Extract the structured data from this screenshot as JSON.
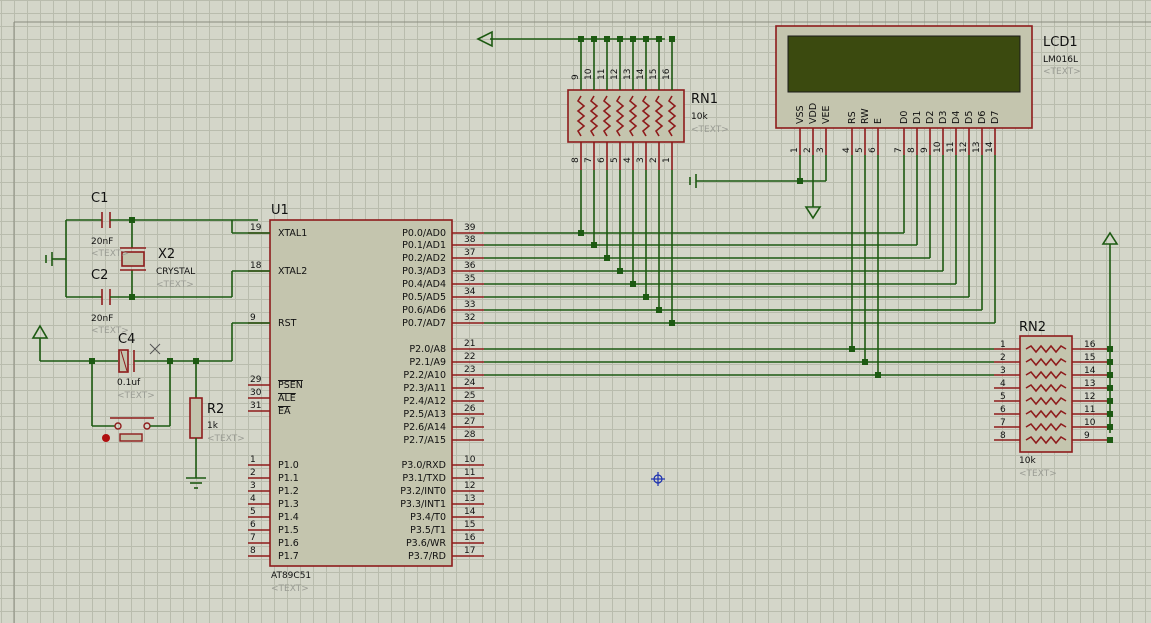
{
  "u1": {
    "ref": "U1",
    "part": "AT89C51",
    "text": "<TEXT>",
    "left": [
      {
        "num": "19",
        "name": "XTAL1"
      },
      {
        "num": "18",
        "name": "XTAL2"
      },
      {
        "num": "9",
        "name": "RST"
      },
      {
        "num": "29",
        "name": "PSEN"
      },
      {
        "num": "30",
        "name": "ALE"
      },
      {
        "num": "31",
        "name": "EA"
      },
      {
        "num": "1",
        "name": "P1.0"
      },
      {
        "num": "2",
        "name": "P1.1"
      },
      {
        "num": "3",
        "name": "P1.2"
      },
      {
        "num": "4",
        "name": "P1.3"
      },
      {
        "num": "5",
        "name": "P1.4"
      },
      {
        "num": "6",
        "name": "P1.5"
      },
      {
        "num": "7",
        "name": "P1.6"
      },
      {
        "num": "8",
        "name": "P1.7"
      }
    ],
    "right": [
      {
        "num": "39",
        "name": "P0.0/AD0"
      },
      {
        "num": "38",
        "name": "P0.1/AD1"
      },
      {
        "num": "37",
        "name": "P0.2/AD2"
      },
      {
        "num": "36",
        "name": "P0.3/AD3"
      },
      {
        "num": "35",
        "name": "P0.4/AD4"
      },
      {
        "num": "34",
        "name": "P0.5/AD5"
      },
      {
        "num": "33",
        "name": "P0.6/AD6"
      },
      {
        "num": "32",
        "name": "P0.7/AD7"
      },
      {
        "num": "21",
        "name": "P2.0/A8"
      },
      {
        "num": "22",
        "name": "P2.1/A9"
      },
      {
        "num": "23",
        "name": "P2.2/A10"
      },
      {
        "num": "24",
        "name": "P2.3/A11"
      },
      {
        "num": "25",
        "name": "P2.4/A12"
      },
      {
        "num": "26",
        "name": "P2.5/A13"
      },
      {
        "num": "27",
        "name": "P2.6/A14"
      },
      {
        "num": "28",
        "name": "P2.7/A15"
      },
      {
        "num": "10",
        "name": "P3.0/RXD"
      },
      {
        "num": "11",
        "name": "P3.1/TXD"
      },
      {
        "num": "12",
        "name": "P3.2/INT0"
      },
      {
        "num": "13",
        "name": "P3.3/INT1"
      },
      {
        "num": "14",
        "name": "P3.4/T0"
      },
      {
        "num": "15",
        "name": "P3.5/T1"
      },
      {
        "num": "16",
        "name": "P3.6/WR"
      },
      {
        "num": "17",
        "name": "P3.7/RD"
      }
    ]
  },
  "lcd": {
    "ref": "LCD1",
    "part": "LM016L",
    "text": "<TEXT>",
    "pins": [
      {
        "name": "VSS",
        "num": "1"
      },
      {
        "name": "VDD",
        "num": "2"
      },
      {
        "name": "VEE",
        "num": "3"
      },
      {
        "name": "RS",
        "num": "4"
      },
      {
        "name": "RW",
        "num": "5"
      },
      {
        "name": "E",
        "num": "6"
      },
      {
        "name": "D0",
        "num": "7"
      },
      {
        "name": "D1",
        "num": "8"
      },
      {
        "name": "D2",
        "num": "9"
      },
      {
        "name": "D3",
        "num": "10"
      },
      {
        "name": "D4",
        "num": "11"
      },
      {
        "name": "D5",
        "num": "12"
      },
      {
        "name": "D6",
        "num": "13"
      },
      {
        "name": "D7",
        "num": "14"
      }
    ]
  },
  "rn1": {
    "ref": "RN1",
    "value": "10k",
    "text": "<TEXT>",
    "top_pins": [
      "9",
      "10",
      "11",
      "12",
      "13",
      "14",
      "15",
      "16"
    ],
    "bottom_pins": [
      "8",
      "7",
      "6",
      "5",
      "4",
      "3",
      "2",
      "1"
    ]
  },
  "rn2": {
    "ref": "RN2",
    "value": "10k",
    "text": "<TEXT>",
    "left_pins": [
      "1",
      "2",
      "3",
      "4",
      "5",
      "6",
      "7",
      "8"
    ],
    "right_pins": [
      "16",
      "15",
      "14",
      "13",
      "12",
      "11",
      "10",
      "9"
    ]
  },
  "c1": {
    "ref": "C1",
    "value": "20nF",
    "text": "<TEXT>"
  },
  "c2": {
    "ref": "C2",
    "value": "20nF",
    "text": "<TEXT>"
  },
  "c4": {
    "ref": "C4",
    "value": "0.1uf",
    "text": "<TEXT>"
  },
  "x2": {
    "ref": "X2",
    "value": "CRYSTAL",
    "text": "<TEXT>"
  },
  "r2": {
    "ref": "R2",
    "value": "1k",
    "text": "<TEXT>"
  }
}
